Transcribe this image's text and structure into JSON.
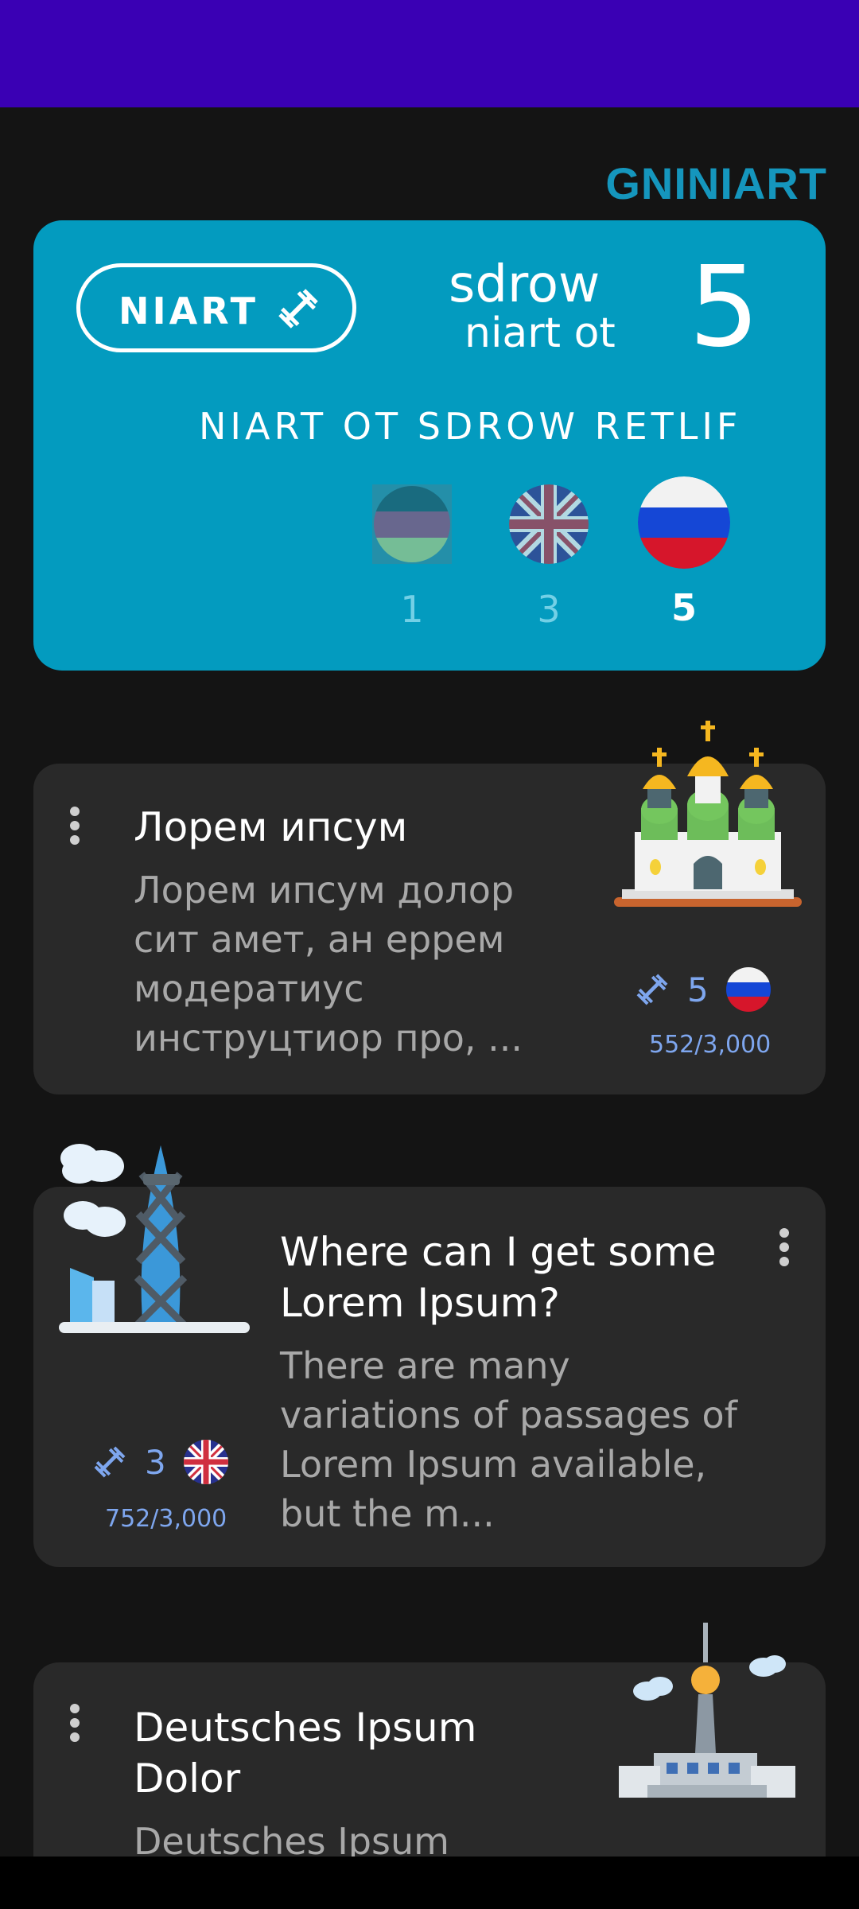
{
  "header": {
    "section_title": "GNINIART"
  },
  "train_card": {
    "train_button_label": "NIART",
    "words_line1": "sdrow",
    "words_line2": "niart ot",
    "words_count": "5",
    "filter_label": "NIART  OT  SDROW  RETLIF",
    "flags": [
      {
        "name": "flag-1",
        "count": "1"
      },
      {
        "name": "uk-flag",
        "count": "3"
      },
      {
        "name": "russia-flag",
        "count": "5"
      }
    ]
  },
  "lessons": [
    {
      "title": "Лорем ипсум",
      "description": "Лорем ипсум долор сит амет, ан еррем модератиус инструцтиор про, ...",
      "word_count": "5",
      "progress": "552/3,000",
      "flag": "russia-flag",
      "image": "church-icon"
    },
    {
      "title": "Where can I get some Lorem Ipsum?",
      "description": "There are many variations of passages of Lorem Ipsum available, but the m...",
      "word_count": "3",
      "progress": "752/3,000",
      "flag": "uk-flag",
      "image": "london-skyline-icon"
    },
    {
      "title": "Deutsches Ipsum Dolor",
      "description": "Deutsches Ipsum",
      "image": "berlin-tower-icon"
    }
  ],
  "colors": {
    "status_bar": "#3a00b4",
    "accent": "#039bbf",
    "card_bg": "#292929",
    "stat_blue": "#7ea6ee"
  }
}
